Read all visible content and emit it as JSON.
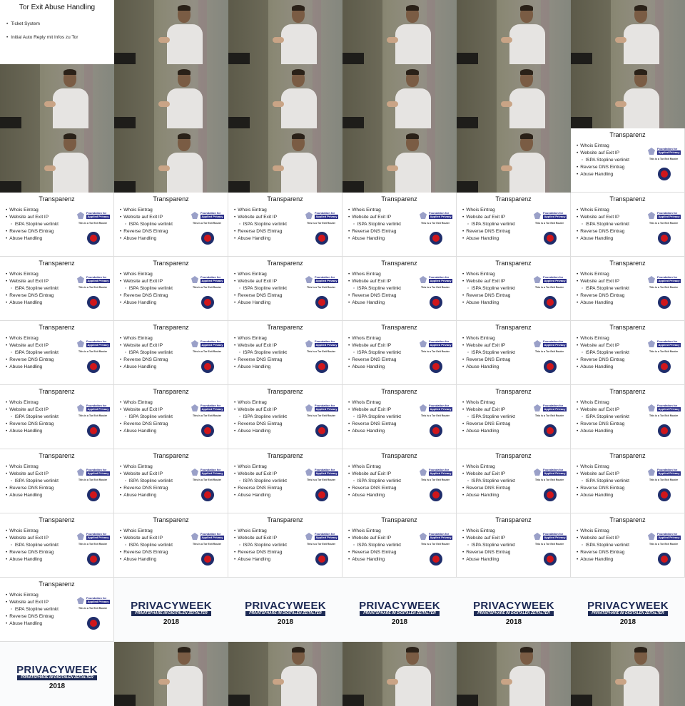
{
  "intro_slide": {
    "title": "Tor Exit Abuse Handling",
    "items": [
      "Ticket System",
      "Initial Auto Reply mit Infos zu Tor"
    ]
  },
  "transparency_slide": {
    "title": "Transparenz",
    "items": [
      {
        "text": "Whois Eintrag",
        "sub": false
      },
      {
        "text": "Website auf Exit IP",
        "sub": false
      },
      {
        "text": "ISPA Stopline verlinkt",
        "sub": true
      },
      {
        "text": "Reverse DNS Eintrag",
        "sub": false
      },
      {
        "text": "Abuse Handling",
        "sub": false
      }
    ],
    "logo_line1": "Foundation for",
    "logo_line2": "Applied Privacy",
    "exit_text": "This is a Tor Exit Router"
  },
  "privacy_week": {
    "title": "PRIVACYWEEK",
    "subtitle": "PRIVATSPHÄRE IM DIGITALEN ZEITALTER",
    "year": "2018"
  },
  "tiles": [
    "intro",
    "speaker",
    "speaker",
    "speaker",
    "speaker",
    "speaker",
    "speaker",
    "speaker",
    "speaker",
    "speaker",
    "speaker",
    "speaker",
    "speaker",
    "speaker",
    "speaker",
    "speaker",
    "speaker",
    "slide",
    "slide",
    "slide",
    "slide",
    "slide",
    "slide",
    "slide",
    "slide",
    "slide",
    "slide",
    "slide",
    "slide",
    "slide",
    "slide",
    "slide",
    "slide",
    "slide",
    "slide",
    "slide",
    "slide",
    "slide",
    "slide",
    "slide",
    "slide",
    "slide",
    "slide",
    "slide",
    "slide",
    "slide",
    "slide",
    "slide",
    "slide",
    "slide",
    "slide",
    "slide",
    "slide",
    "slide",
    "slide",
    "pw",
    "pw",
    "pw",
    "pw",
    "pw",
    "pw",
    "speaker",
    "speaker",
    "speaker",
    "speaker",
    "speaker"
  ]
}
